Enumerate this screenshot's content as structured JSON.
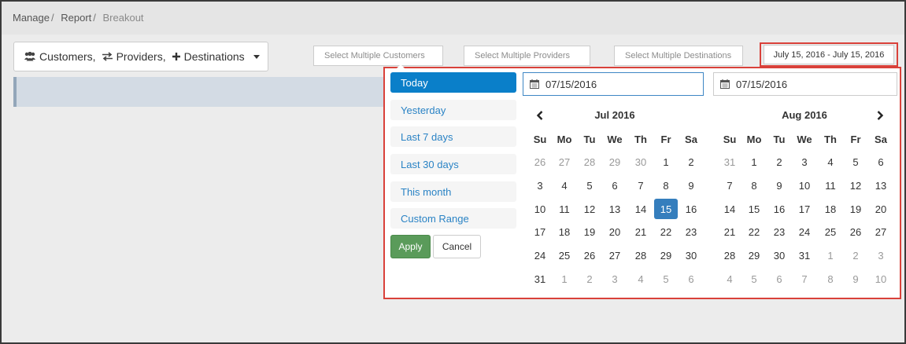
{
  "breadcrumb": {
    "items": [
      "Manage",
      "Report"
    ],
    "current": "Breakout"
  },
  "entity_dropdown": {
    "items": [
      {
        "label": "Customers,",
        "icon": "users-icon"
      },
      {
        "label": "Providers,",
        "icon": "exchange-icon"
      },
      {
        "label": "Destinations",
        "icon": "plus-icon"
      }
    ]
  },
  "filters": {
    "customers_placeholder": "Select Multiple Customers",
    "providers_placeholder": "Select Multiple Providers",
    "destinations_placeholder": "Select Multiple Destinations"
  },
  "date_range": {
    "value": "July 15, 2016 - July 15, 2016"
  },
  "picker": {
    "ranges": [
      "Today",
      "Yesterday",
      "Last 7 days",
      "Last 30 days",
      "This month",
      "Custom Range"
    ],
    "active_range": "Today",
    "apply_label": "Apply",
    "cancel_label": "Cancel",
    "start_date": "07/15/2016",
    "end_date": "07/15/2016",
    "weekdays": [
      "Su",
      "Mo",
      "Tu",
      "We",
      "Th",
      "Fr",
      "Sa"
    ],
    "calendars": [
      {
        "title": "Jul 2016",
        "weeks": [
          [
            [
              "26",
              "off"
            ],
            [
              "27",
              "off"
            ],
            [
              "28",
              "off"
            ],
            [
              "29",
              "off"
            ],
            [
              "30",
              "off"
            ],
            [
              "1",
              ""
            ],
            [
              "2",
              ""
            ]
          ],
          [
            [
              "3",
              ""
            ],
            [
              "4",
              ""
            ],
            [
              "5",
              ""
            ],
            [
              "6",
              ""
            ],
            [
              "7",
              ""
            ],
            [
              "8",
              ""
            ],
            [
              "9",
              ""
            ]
          ],
          [
            [
              "10",
              ""
            ],
            [
              "11",
              ""
            ],
            [
              "12",
              ""
            ],
            [
              "13",
              ""
            ],
            [
              "14",
              ""
            ],
            [
              "15",
              "sel"
            ],
            [
              "16",
              ""
            ]
          ],
          [
            [
              "17",
              ""
            ],
            [
              "18",
              ""
            ],
            [
              "19",
              ""
            ],
            [
              "20",
              ""
            ],
            [
              "21",
              ""
            ],
            [
              "22",
              ""
            ],
            [
              "23",
              ""
            ]
          ],
          [
            [
              "24",
              ""
            ],
            [
              "25",
              ""
            ],
            [
              "26",
              ""
            ],
            [
              "27",
              ""
            ],
            [
              "28",
              ""
            ],
            [
              "29",
              ""
            ],
            [
              "30",
              ""
            ]
          ],
          [
            [
              "31",
              ""
            ],
            [
              "1",
              "off"
            ],
            [
              "2",
              "off"
            ],
            [
              "3",
              "off"
            ],
            [
              "4",
              "off"
            ],
            [
              "5",
              "off"
            ],
            [
              "6",
              "off"
            ]
          ]
        ]
      },
      {
        "title": "Aug 2016",
        "weeks": [
          [
            [
              "31",
              "off"
            ],
            [
              "1",
              ""
            ],
            [
              "2",
              ""
            ],
            [
              "3",
              ""
            ],
            [
              "4",
              ""
            ],
            [
              "5",
              ""
            ],
            [
              "6",
              ""
            ]
          ],
          [
            [
              "7",
              ""
            ],
            [
              "8",
              ""
            ],
            [
              "9",
              ""
            ],
            [
              "10",
              ""
            ],
            [
              "11",
              ""
            ],
            [
              "12",
              ""
            ],
            [
              "13",
              ""
            ]
          ],
          [
            [
              "14",
              ""
            ],
            [
              "15",
              ""
            ],
            [
              "16",
              ""
            ],
            [
              "17",
              ""
            ],
            [
              "18",
              ""
            ],
            [
              "19",
              ""
            ],
            [
              "20",
              ""
            ]
          ],
          [
            [
              "21",
              ""
            ],
            [
              "22",
              ""
            ],
            [
              "23",
              ""
            ],
            [
              "24",
              ""
            ],
            [
              "25",
              ""
            ],
            [
              "26",
              ""
            ],
            [
              "27",
              ""
            ]
          ],
          [
            [
              "28",
              ""
            ],
            [
              "29",
              ""
            ],
            [
              "30",
              ""
            ],
            [
              "31",
              ""
            ],
            [
              "1",
              "off"
            ],
            [
              "2",
              "off"
            ],
            [
              "3",
              "off"
            ]
          ],
          [
            [
              "4",
              "off"
            ],
            [
              "5",
              "off"
            ],
            [
              "6",
              "off"
            ],
            [
              "7",
              "off"
            ],
            [
              "8",
              "off"
            ],
            [
              "9",
              "off"
            ],
            [
              "10",
              "off"
            ]
          ]
        ]
      }
    ]
  },
  "colors": {
    "active_range_bg": "#0a7fc9",
    "selected_date_bg": "#357ebd",
    "apply_bg": "#5a9b5a",
    "highlight_border": "#d9413a",
    "link": "#2a83c5"
  }
}
